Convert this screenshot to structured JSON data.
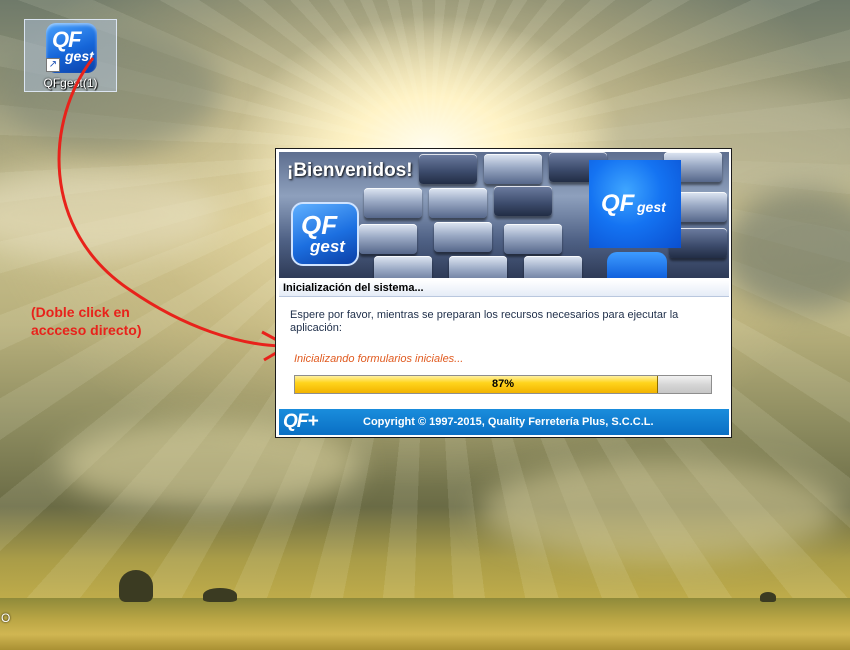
{
  "desktop": {
    "icon": {
      "logo_qf": "QF",
      "logo_gest": "gest",
      "label": "QFgest(1)"
    },
    "annotation": {
      "line1": "(Doble click en",
      "line2": "accceso directo)",
      "color": "#e8221b"
    },
    "edge_text": "O"
  },
  "splash": {
    "banner_title": "¡Bienvenidos!",
    "logo_small_qf": "QF",
    "logo_small_gest": "gest",
    "logo_big_qf": "QF",
    "logo_big_gest": "gest",
    "status_title": "Inicialización del sistema...",
    "message": "Espere por favor, mientras se preparan los recursos necesarios para ejecutar la aplicación:",
    "progress_text": "Inicializando formularios iniciales...",
    "progress": {
      "value": 0.87,
      "label": "87%"
    },
    "footer_brand": "QF+",
    "copyright": "Copyright © 1997-2015, Quality Ferretería Plus, S.C.C.L.",
    "colors": {
      "footer": "#0a6fc4",
      "progress_fill": "#ffd41c",
      "progress_text": "#e05a1f"
    }
  }
}
